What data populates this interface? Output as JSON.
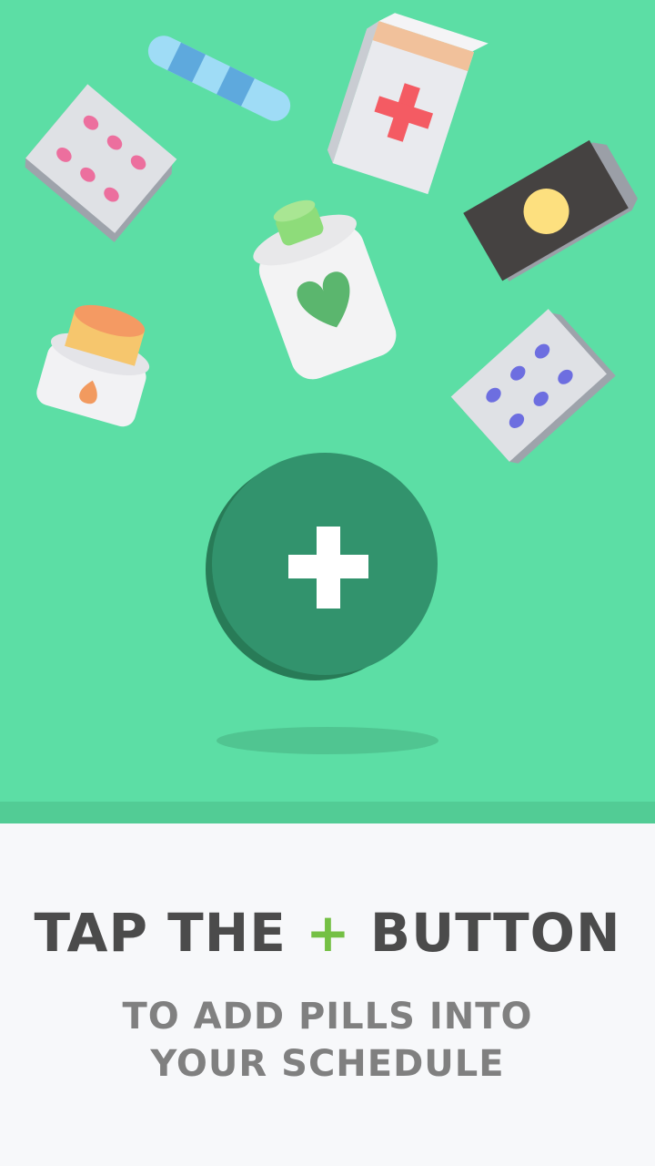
{
  "onboarding": {
    "headline_part1": "TAP THE",
    "headline_plus": "+",
    "headline_part2": "BUTTON",
    "subtitle_line1": "TO ADD PILLS INTO",
    "subtitle_line2": "YOUR SCHEDULE"
  },
  "colors": {
    "hero_background": "#5cdea5",
    "add_button": "#32936d",
    "plus_accent": "#74c044",
    "headline_text": "#4b4b4b",
    "subtitle_text": "#808080"
  },
  "icons": [
    "pill-capsule-icon",
    "blister-pack-icon",
    "first-aid-box-icon",
    "pill-box-icon",
    "pill-bottle-icon",
    "ointment-jar-icon",
    "add-plus-icon"
  ]
}
